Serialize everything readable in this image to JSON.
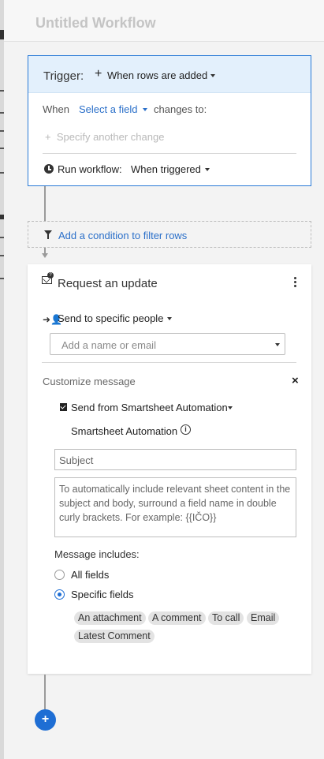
{
  "header": {
    "title": "Untitled Workflow"
  },
  "trigger": {
    "label": "Trigger:",
    "plus": "+",
    "value": "When rows are added",
    "when_label": "When",
    "field_placeholder": "Select a field",
    "changes_to": "changes to:",
    "specify_plus": "+",
    "specify": "Specify another change",
    "run_label": "Run workflow:",
    "run_value": "When triggered"
  },
  "condition": {
    "label": "Add a condition to filter rows"
  },
  "action": {
    "title": "Request an update",
    "send_label": "Send to specific people",
    "name_placeholder": "Add a name or email",
    "customize_label": "Customize message",
    "close": "×",
    "send_from": "Send from Smartsheet Automation",
    "sender_name": "Smartsheet Automation",
    "info": "i",
    "subject_placeholder": "Subject",
    "body_placeholder": "To automatically include relevant sheet content in the subject and body, surround a field name in double curly brackets. For example: {{IČO}}",
    "message_includes": "Message includes:",
    "options": [
      {
        "label": "All fields",
        "selected": false
      },
      {
        "label": "Specific fields",
        "selected": true
      }
    ],
    "fields": [
      "An attachment",
      "A comment",
      "To call",
      "Email",
      "Latest Comment"
    ]
  },
  "add_button": "+",
  "colors": {
    "accent": "#1e6ed4",
    "link": "#2a6fc9",
    "trigger_header": "#e3f0fc"
  }
}
